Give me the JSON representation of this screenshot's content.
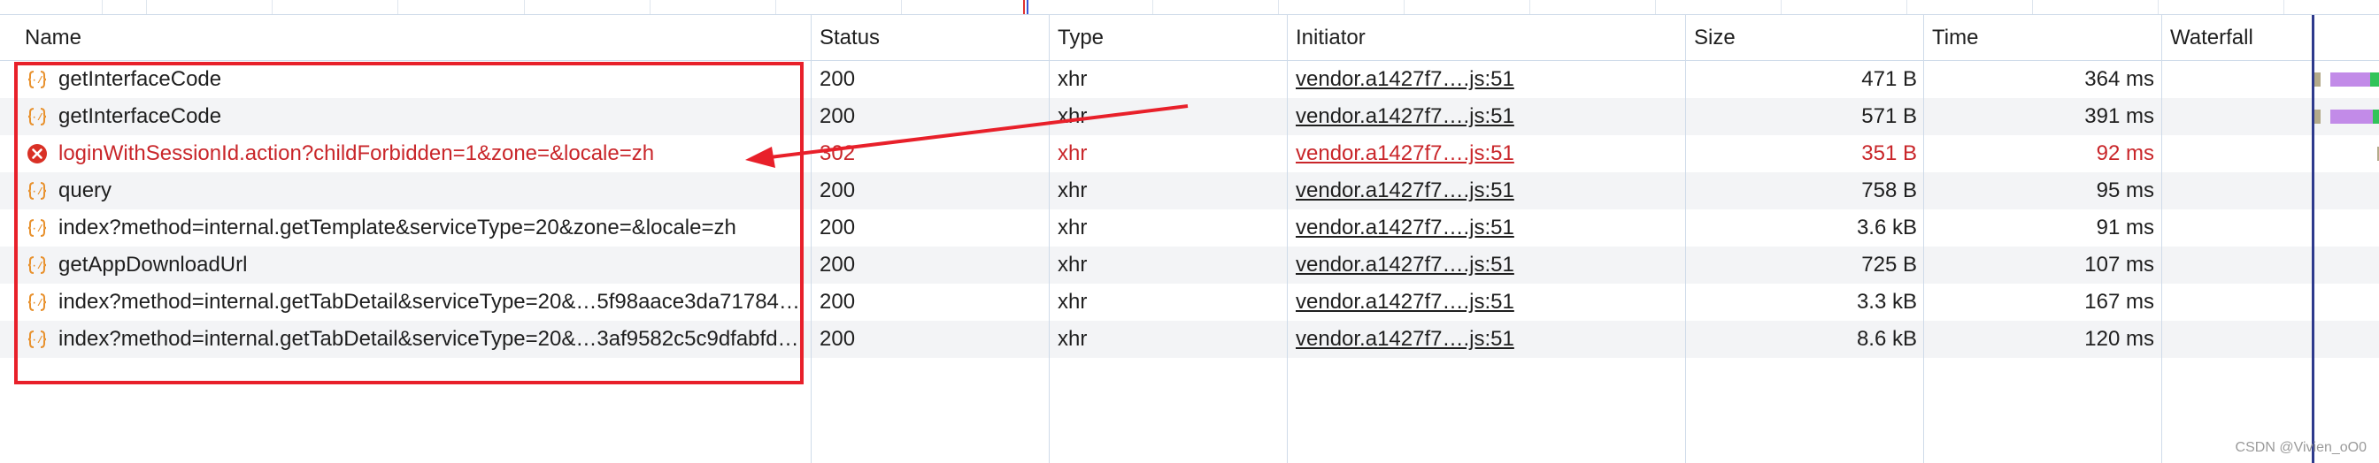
{
  "columns": {
    "name": "Name",
    "status": "Status",
    "type": "Type",
    "initiator": "Initiator",
    "size": "Size",
    "time": "Time",
    "waterfall": "Waterfall"
  },
  "rows": [
    {
      "name": "getInterfaceCode",
      "status": "200",
      "type": "xhr",
      "initiator": "vendor.a1427f7….js:51",
      "size": "471 B",
      "time": "364 ms",
      "icon": "fetch-icon",
      "error": false
    },
    {
      "name": "getInterfaceCode",
      "status": "200",
      "type": "xhr",
      "initiator": "vendor.a1427f7….js:51",
      "size": "571 B",
      "time": "391 ms",
      "icon": "fetch-icon",
      "error": false
    },
    {
      "name": "loginWithSessionId.action?childForbidden=1&zone=&locale=zh",
      "status": "302",
      "type": "xhr",
      "initiator": "vendor.a1427f7….js:51",
      "size": "351 B",
      "time": "92 ms",
      "icon": "error-icon",
      "error": true
    },
    {
      "name": "query",
      "status": "200",
      "type": "xhr",
      "initiator": "vendor.a1427f7….js:51",
      "size": "758 B",
      "time": "95 ms",
      "icon": "fetch-icon",
      "error": false
    },
    {
      "name": "index?method=internal.getTemplate&serviceType=20&zone=&locale=zh",
      "status": "200",
      "type": "xhr",
      "initiator": "vendor.a1427f7….js:51",
      "size": "3.6 kB",
      "time": "91 ms",
      "icon": "fetch-icon",
      "error": false
    },
    {
      "name": "getAppDownloadUrl",
      "status": "200",
      "type": "xhr",
      "initiator": "vendor.a1427f7….js:51",
      "size": "725 B",
      "time": "107 ms",
      "icon": "fetch-icon",
      "error": false
    },
    {
      "name": "index?method=internal.getTabDetail&serviceType=20&…5f98aace3da71784…",
      "status": "200",
      "type": "xhr",
      "initiator": "vendor.a1427f7….js:51",
      "size": "3.3 kB",
      "time": "167 ms",
      "icon": "fetch-icon",
      "error": false
    },
    {
      "name": "index?method=internal.getTabDetail&serviceType=20&…3af9582c5c9dfabfd…",
      "status": "200",
      "type": "xhr",
      "initiator": "vendor.a1427f7….js:51",
      "size": "8.6 kB",
      "time": "120 ms",
      "icon": "fetch-icon",
      "error": false
    }
  ],
  "annotation": {
    "color": "#e8202a"
  },
  "colors": {
    "error": "#c9262a",
    "fetch_icon": "#e8912d",
    "waterfall_waiting": "#b3aa8a",
    "waterfall_download": "#c28be8",
    "waterfall_green": "#31c45a",
    "waterfall_line": "#2e3a8c"
  },
  "watermark": "CSDN @Vivien_oO0"
}
